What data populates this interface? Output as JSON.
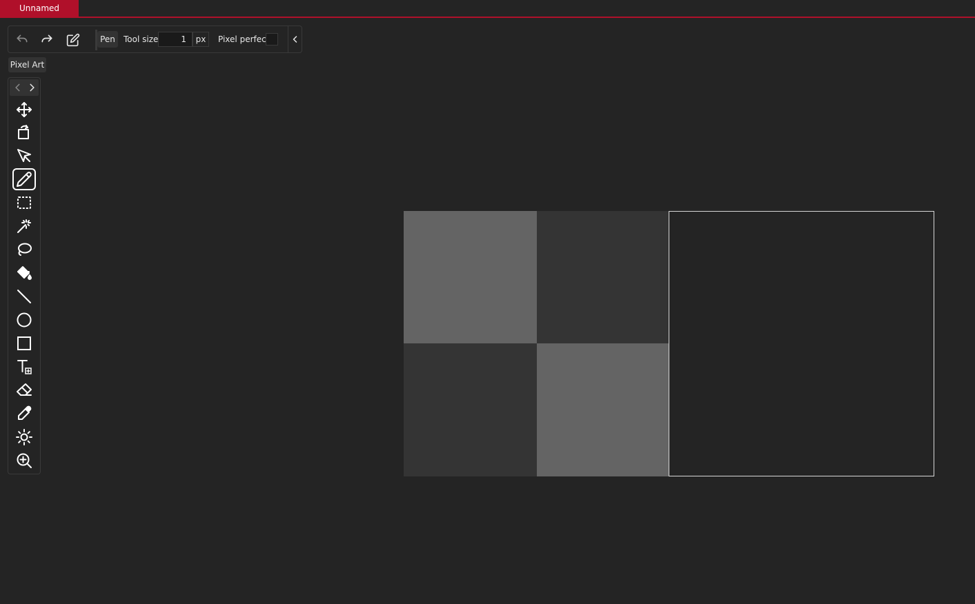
{
  "tab": {
    "title": "Unnamed"
  },
  "toolbar": {
    "undo_icon": "undo-icon",
    "redo_icon": "redo-icon",
    "edit_icon": "edit-icon",
    "tool_name": "Pen",
    "tool_size_label": "Tool size",
    "tool_size_value": "1",
    "tool_size_unit": "px",
    "pixel_perfect_label": "Pixel perfect",
    "pixel_perfect_checked": false
  },
  "tooltip": {
    "text": "Pixel Art"
  },
  "tools": {
    "active": "pen",
    "items": [
      "move-icon",
      "rotate-icon",
      "select-arrow-icon",
      "pen-icon",
      "rect-select-icon",
      "magic-wand-icon",
      "lasso-icon",
      "fill-bucket-icon",
      "line-icon",
      "ellipse-icon",
      "rectangle-icon",
      "text-icon",
      "eraser-icon",
      "eyedropper-icon",
      "brightness-icon",
      "zoom-icon"
    ]
  },
  "colors": {
    "accent": "#b0102a",
    "background": "#242424",
    "panel_border": "#3a3a3a",
    "checker_light": "#646464",
    "checker_dark": "#343434",
    "frame_border": "#d8d8d8"
  }
}
